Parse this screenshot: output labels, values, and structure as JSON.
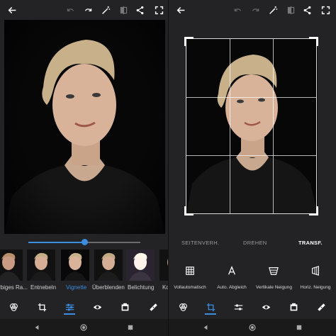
{
  "left": {
    "slider": {
      "value": 0.5
    },
    "thumbnails": [
      {
        "label": "rbiges Ra...",
        "active": false
      },
      {
        "label": "Entnebeln",
        "active": false
      },
      {
        "label": "Vignette",
        "active": true
      },
      {
        "label": "Überblenden",
        "active": false
      },
      {
        "label": "Belichtung",
        "active": false
      },
      {
        "label": "Ko",
        "active": false
      }
    ]
  },
  "right": {
    "tabs": [
      {
        "label": "SEITENVERH.",
        "active": false
      },
      {
        "label": "DREHEN",
        "active": false
      },
      {
        "label": "TRANSF.",
        "active": true
      }
    ],
    "tools": [
      {
        "label": "Vollautomatisch",
        "icon": "grid-icon"
      },
      {
        "label": "Auto. Abgleich",
        "icon": "letter-a-icon"
      },
      {
        "label": "Vertikale Neigung",
        "icon": "vertical-tilt-icon"
      },
      {
        "label": "Horiz. Neigung",
        "icon": "horizontal-tilt-icon"
      }
    ]
  },
  "colors": {
    "accent": "#3b8de0",
    "background": "#232325"
  }
}
